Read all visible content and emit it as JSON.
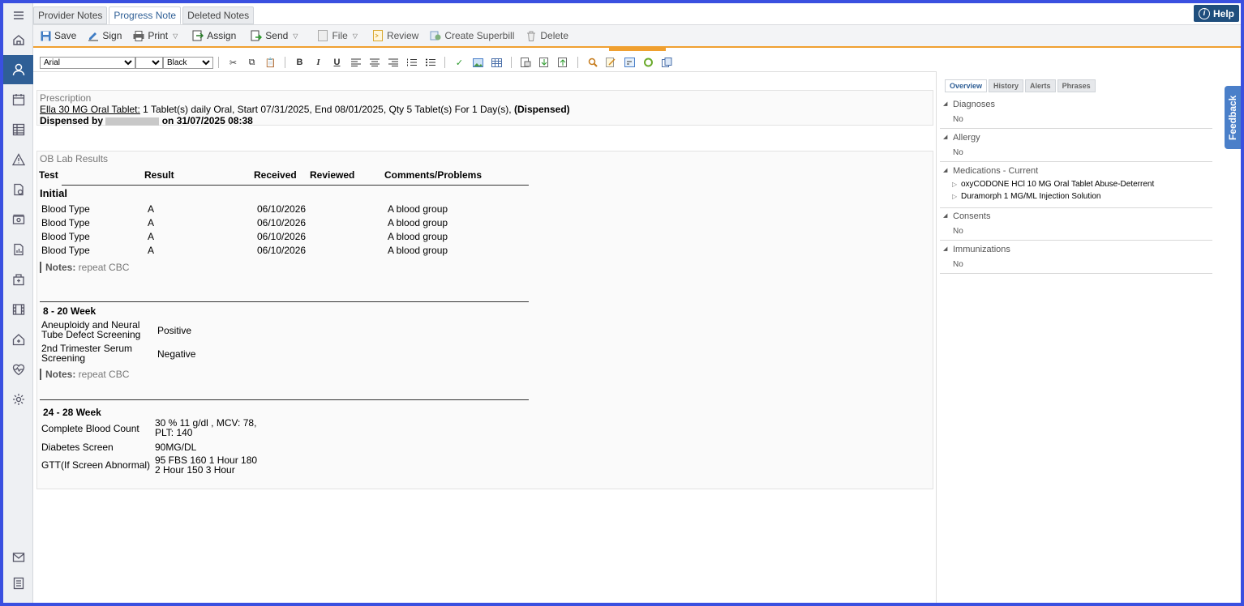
{
  "tabs": [
    {
      "label": "Provider Notes"
    },
    {
      "label": "Progress Note"
    },
    {
      "label": "Deleted Notes"
    }
  ],
  "help_label": "Help",
  "toolbar": {
    "save": "Save",
    "sign": "Sign",
    "print": "Print",
    "assign": "Assign",
    "send": "Send",
    "file": "File",
    "review": "Review",
    "superbill": "Create Superbill",
    "delete": "Delete"
  },
  "format": {
    "font": "Arial",
    "size": "",
    "color": "Black"
  },
  "prescription": {
    "title": "Prescription",
    "drug": "Ella 30 MG Oral Tablet:",
    "detail": " 1 Tablet(s) daily Oral, Start 07/31/2025, End 08/01/2025, Qty 5 Tablet(s) For 1 Day(s), ",
    "status": "(Dispensed)",
    "dispensed_by": "Dispensed by",
    "dispensed_on": " on 31/07/2025 08:38"
  },
  "ob": {
    "title": "OB Lab Results",
    "headers": {
      "test": "Test",
      "result": "Result",
      "received": "Received",
      "reviewed": "Reviewed",
      "comments": "Comments/Problems"
    },
    "initial": {
      "label": "Initial",
      "rows": [
        {
          "test": "Blood Type",
          "result": "A",
          "received": "06/10/2026",
          "comments": "A blood group"
        },
        {
          "test": "Blood Type",
          "result": "A",
          "received": "06/10/2026",
          "comments": "A blood group"
        },
        {
          "test": "Blood Type",
          "result": "A",
          "received": "06/10/2026",
          "comments": "A blood group"
        },
        {
          "test": "Blood Type",
          "result": "A",
          "received": "06/10/2026",
          "comments": "A blood group"
        }
      ],
      "notes_label": "Notes:",
      "notes": " repeat CBC"
    },
    "week8": {
      "label": "8 - 20 Week",
      "rows": [
        {
          "test": "Aneuploidy and Neural Tube Defect Screening",
          "result": "Positive"
        },
        {
          "test": "2nd Trimester Serum Screening",
          "result": "Negative"
        }
      ],
      "notes_label": "Notes:",
      "notes": " repeat CBC"
    },
    "week24": {
      "label": "24 - 28 Week",
      "rows": [
        {
          "test": "Complete Blood Count",
          "result": "30 % 11 g/dl , MCV: 78, PLT: 140"
        },
        {
          "test": "Diabetes Screen",
          "result": "90MG/DL"
        },
        {
          "test": "GTT(If Screen Abnormal)",
          "result": "95 FBS 160 1 Hour 180 2 Hour 150 3 Hour"
        }
      ]
    }
  },
  "right_tabs": [
    {
      "label": "Overview"
    },
    {
      "label": "History"
    },
    {
      "label": "Alerts"
    },
    {
      "label": "Phrases"
    }
  ],
  "overview": {
    "diagnoses": {
      "title": "Diagnoses",
      "value": "No"
    },
    "allergy": {
      "title": "Allergy",
      "value": "No"
    },
    "medications": {
      "title": "Medications - Current",
      "items": [
        "oxyCODONE HCl 10 MG Oral Tablet Abuse-Deterrent",
        "Duramorph 1 MG/ML Injection Solution"
      ]
    },
    "consents": {
      "title": "Consents",
      "value": "No"
    },
    "immunizations": {
      "title": "Immunizations",
      "value": "No"
    }
  },
  "feedback_label": "Feedback"
}
